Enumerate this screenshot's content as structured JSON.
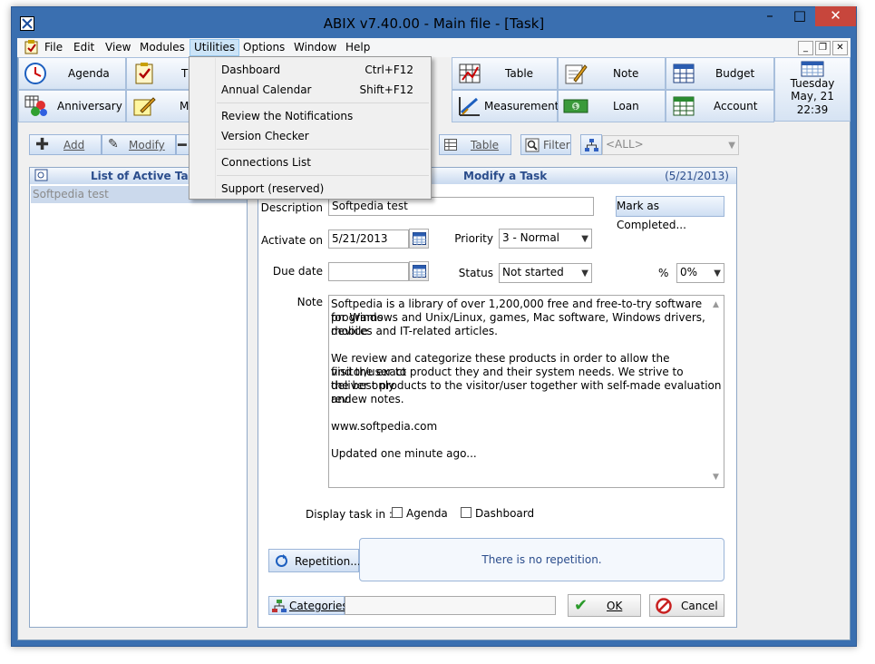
{
  "window": {
    "title": "ABIX v7.40.00  -  Main file - [Task]"
  },
  "menu": [
    {
      "label": "File"
    },
    {
      "label": "Edit"
    },
    {
      "label": "View"
    },
    {
      "label": "Modules"
    },
    {
      "label": "Utilities"
    },
    {
      "label": "Options"
    },
    {
      "label": "Window"
    },
    {
      "label": "Help"
    }
  ],
  "utilities_menu": {
    "items": [
      {
        "label": "Dashboard",
        "shortcut": "Ctrl+F12"
      },
      {
        "label": "Annual Calendar",
        "shortcut": "Shift+F12"
      },
      {
        "label": "Review the Notifications",
        "shortcut": ""
      },
      {
        "label": "Version Checker",
        "shortcut": ""
      },
      {
        "label": "Connections List",
        "shortcut": ""
      },
      {
        "label": "Support (reserved)",
        "shortcut": ""
      }
    ]
  },
  "toolbar": {
    "row1": [
      "Agenda",
      "T",
      "Table",
      "Note",
      "Budget"
    ],
    "row2": [
      "Anniversary",
      "M",
      "Measurement",
      "Loan",
      "Account"
    ]
  },
  "datebox": {
    "day": "Tuesday",
    "date": "May, 21",
    "time": "22:39"
  },
  "actions": {
    "add": "Add",
    "modify": "Modify",
    "table": "Table",
    "filter": "Filter",
    "category_filter": "<ALL>"
  },
  "list_panel": {
    "title": "List of Active Tasks",
    "items": [
      "Softpedia test"
    ]
  },
  "form": {
    "title": "Modify a Task",
    "date": "(5/21/2013)",
    "description_label": "Description",
    "description_value": "Softpedia test",
    "mark_completed": "Mark as Completed...",
    "activate_label": "Activate on",
    "activate_value": "5/21/2013",
    "priority_label": "Priority",
    "priority_value": "3 - Normal",
    "due_label": "Due date",
    "due_value": "",
    "status_label": "Status",
    "status_value": "Not started",
    "percent_label": "%",
    "percent_value": "0%",
    "note_label": "Note",
    "note_lines": [
      "Softpedia is a library of over 1,200,000 free and free-to-try software programs",
      "for Windows and Unix/Linux, games, Mac software, Windows drivers, mobile",
      "devices and IT-related articles.",
      "",
      "We review and categorize these products in order to allow the visitor/user to",
      "find the exact product they and their system needs. We strive to deliver only",
      "the best products to the visitor/user together with self-made evaluation and",
      "review notes.",
      "",
      "www.softpedia.com",
      "",
      "Updated one minute ago..."
    ],
    "display_label": "Display task in :",
    "display_agenda": "Agenda",
    "display_dashboard": "Dashboard",
    "repetition_button": "Repetition...",
    "repetition_text": "There is no repetition.",
    "categories_button": "Categories",
    "ok": "OK",
    "cancel": "Cancel"
  },
  "colors": {
    "accent": "#2b4d8c",
    "window_frame": "#3a6fb0",
    "menu_highlight": "#cce4f7"
  }
}
